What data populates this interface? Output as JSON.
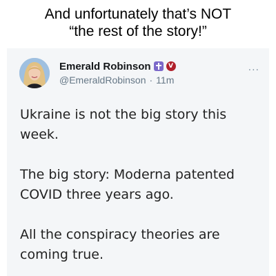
{
  "caption": {
    "line1": "And unfortunately that’s NOT",
    "line2": "“the rest of the story!”"
  },
  "tweet": {
    "author_name": "Emerald Robinson",
    "handle": "@EmeraldRobinson",
    "separator": "·",
    "time": "11m",
    "badge_cross_icon": "cross-badge-icon",
    "badge_verified_icon": "verified-badge-icon",
    "badge_verified_letter": "V",
    "more_label": "...",
    "paragraphs": [
      "Ukraine is not the big story this week.",
      "The big story: Moderna patented COVID three years ago.",
      "All the conspiracy theories are coming true."
    ]
  },
  "colors": {
    "card_background": "#f4f6f8",
    "name": "#14171a",
    "handle": "#657786",
    "body_text": "#222222",
    "cross_badge": "#7b68c9",
    "verified_badge": "#b0202b"
  }
}
